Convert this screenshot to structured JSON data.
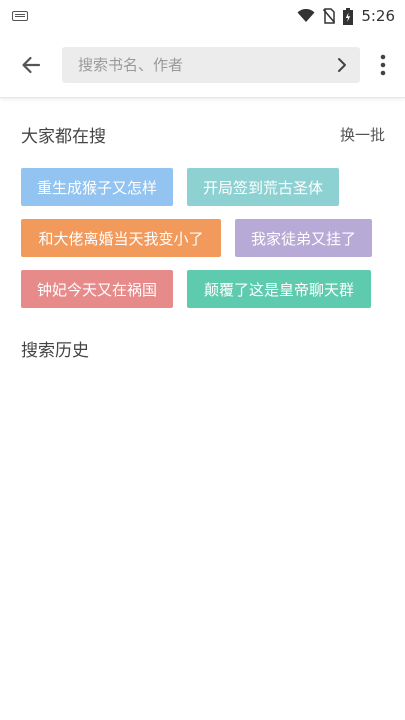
{
  "status_bar": {
    "time": "5:26",
    "icons": [
      "keyboard-icon",
      "wifi-icon",
      "no-sim-icon",
      "battery-icon"
    ]
  },
  "search": {
    "placeholder": "搜索书名、作者",
    "value": ""
  },
  "hot": {
    "title": "大家都在搜",
    "refresh_label": "换一批",
    "tags": [
      {
        "label": "重生成猴子又怎样",
        "color": "#93c3f0"
      },
      {
        "label": "开局签到荒古圣体",
        "color": "#8ed1d3"
      },
      {
        "label": "和大佬离婚当天我变小了",
        "color": "#f19a5c"
      },
      {
        "label": "我家徒弟又挂了",
        "color": "#b8aad6"
      },
      {
        "label": "钟妃今天又在祸国",
        "color": "#e78a8a"
      },
      {
        "label": "颠覆了这是皇帝聊天群",
        "color": "#5fcbae"
      }
    ]
  },
  "history": {
    "title": "搜索历史"
  }
}
